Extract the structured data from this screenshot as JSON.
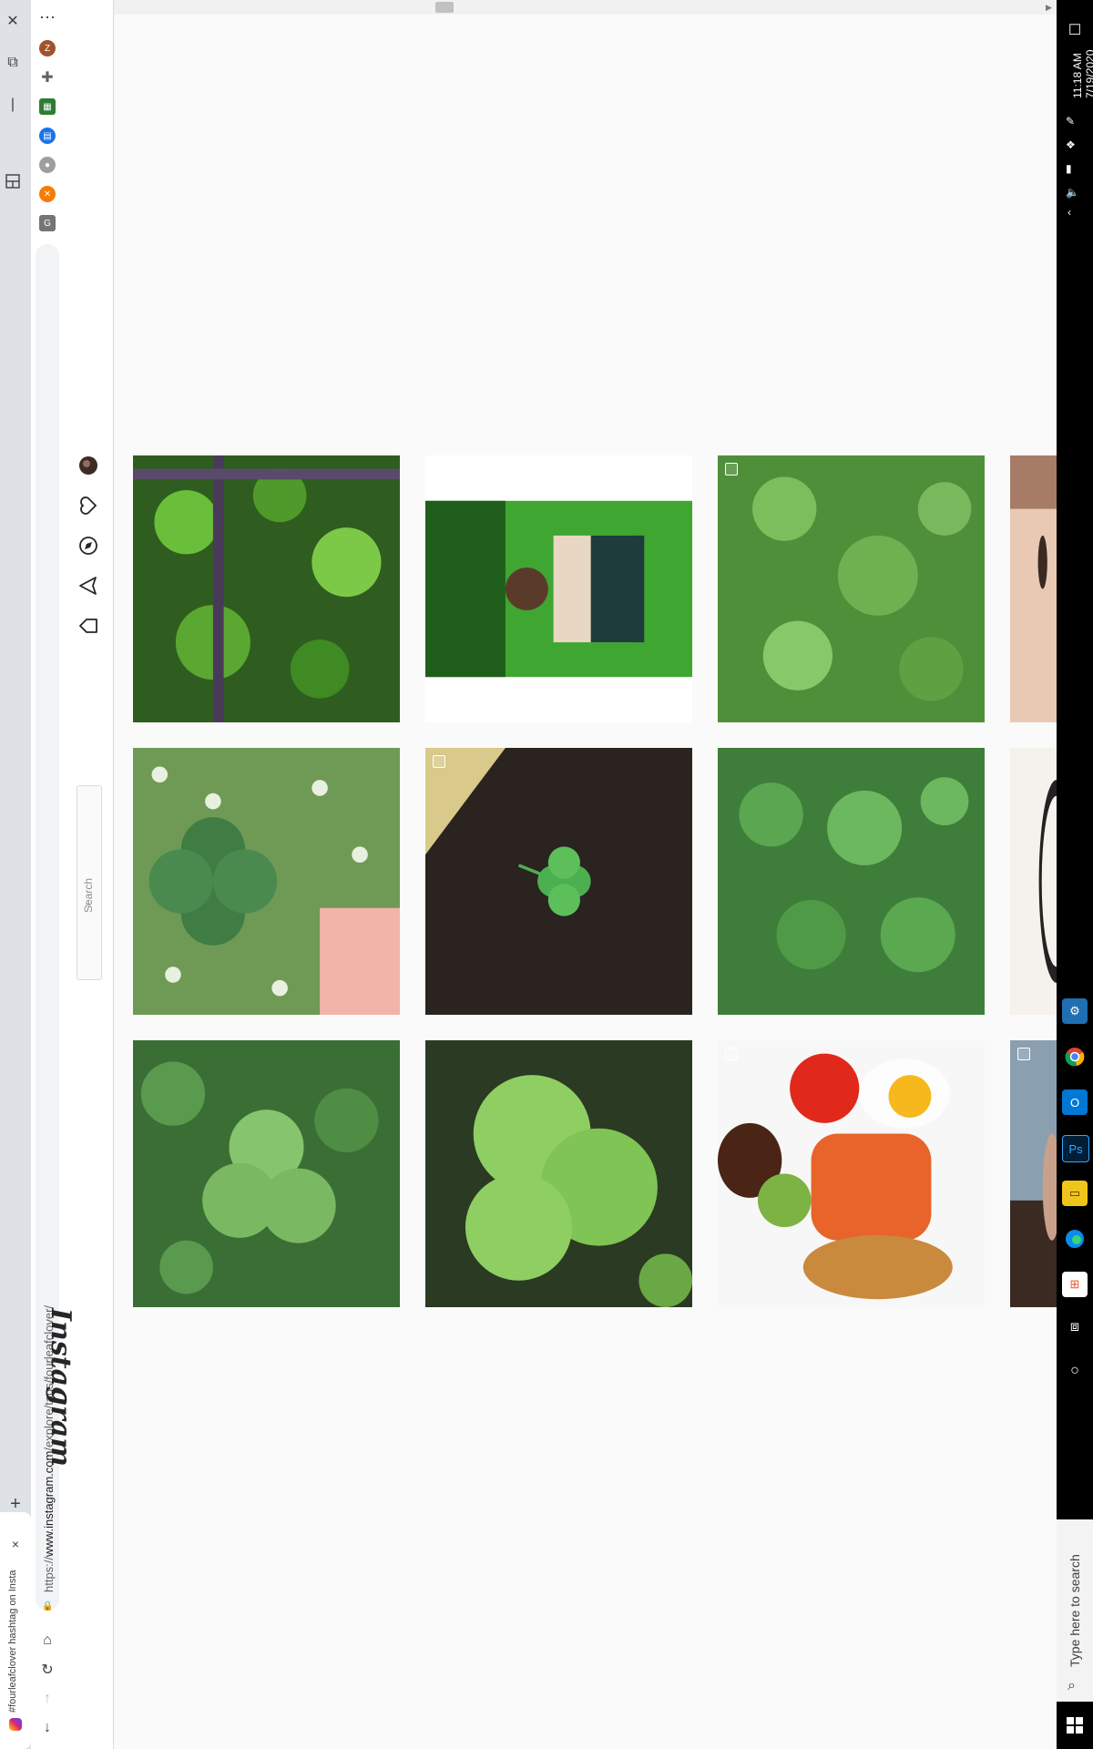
{
  "browser": {
    "tab_title": "#fourleafclover hashtag on Insta",
    "url_scheme": "https://",
    "url_host": "www.instagram.com",
    "url_path": "/explore/tags/fourleafclover/",
    "new_tab_label": "+",
    "close_tab_label": "×"
  },
  "instagram": {
    "logo": "Instagram",
    "search_placeholder": "Search",
    "nav_icons": [
      "home-icon",
      "direct-icon",
      "explore-icon",
      "activity-icon",
      "profile-avatar"
    ]
  },
  "taskbar": {
    "time": "11:18 AM",
    "date": "7/19/2020",
    "search_placeholder": "Type here to search"
  },
  "colors": {
    "clover_green": "#4caf50",
    "ig_border": "#dbdbdb",
    "taskbar_bg": "#000000"
  }
}
